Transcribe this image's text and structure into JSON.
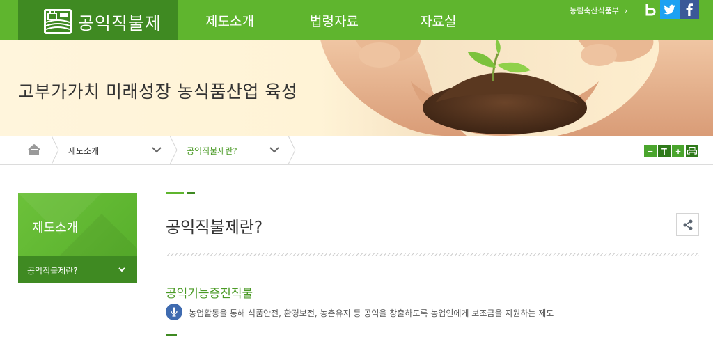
{
  "header": {
    "logo_text": "공익직불제",
    "nav": [
      "제도소개",
      "법령자료",
      "자료실"
    ],
    "top_link": "농림축산식품부",
    "sns": [
      {
        "name": "blog",
        "glyph": "b",
        "color": "#5fb52e"
      },
      {
        "name": "twitter",
        "glyph": "t",
        "color": "#1da1f2"
      },
      {
        "name": "facebook",
        "glyph": "f",
        "color": "#3b5998"
      }
    ]
  },
  "banner": {
    "title": "고부가가치 미래성장 농식품산업 육성"
  },
  "breadcrumb": {
    "level1": "제도소개",
    "level2": "공익직불제란?"
  },
  "tools": [
    "−",
    "T",
    "+",
    "print"
  ],
  "sidebar": {
    "title": "제도소개",
    "items": [
      {
        "label": "공익직불제란?"
      }
    ]
  },
  "content": {
    "page_title": "공익직불제란?",
    "section_title": "공익기능증진직불",
    "description": "농업활동을 통해 식품안전, 환경보전, 농촌유지 등 공익을 창출하도록 농업인에게 보조금을 지원하는 제도"
  },
  "colors": {
    "brand_green": "#5fb52e",
    "dark_green": "#3f8a22",
    "accent_text": "#4a9a25"
  }
}
